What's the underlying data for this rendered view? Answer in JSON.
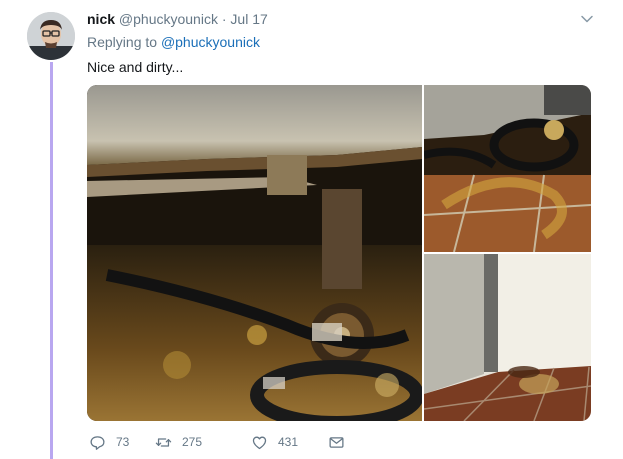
{
  "tweet": {
    "author_name": "nick",
    "author_handle": "@phuckyounick",
    "separator": "·",
    "date": "Jul 17",
    "replying_prefix": "Replying to",
    "replying_handle": "@phuckyounick",
    "text": "Nice and dirty..."
  },
  "media": {
    "photo_count": 3
  },
  "actions": {
    "replies": "73",
    "retweets": "275",
    "likes": "431"
  },
  "icons": {
    "more": "chevron-down-icon",
    "reply": "reply-icon",
    "retweet": "retweet-icon",
    "like": "heart-icon",
    "dm": "envelope-icon"
  },
  "colors": {
    "thread_line": "#b9a7f0",
    "link": "#1b6fb8",
    "secondary_text": "#657786",
    "primary_text": "#14171a"
  }
}
